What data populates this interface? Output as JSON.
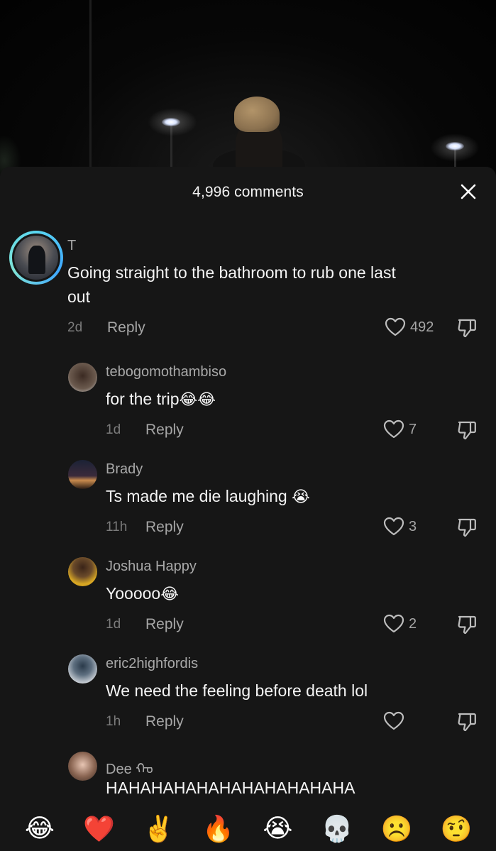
{
  "header": {
    "title": "4,996 comments",
    "close_icon": "close-icon"
  },
  "comments": [
    {
      "username": "T",
      "text_line1": "Going straight to the bathroom to rub one last",
      "text_line2": "out",
      "time": "2d",
      "reply": "Reply",
      "likes": "492"
    },
    {
      "username": "tebogomothambiso",
      "text": "for the trip",
      "emoji": "😂😂",
      "time": "1d",
      "reply": "Reply",
      "likes": "7"
    },
    {
      "username": "Brady",
      "text": "Ts made me die laughing ",
      "emoji": "😭",
      "time": "11h",
      "reply": "Reply",
      "likes": "3"
    },
    {
      "username": "Joshua Happy",
      "text": "Yooooo",
      "emoji": "😂",
      "time": "1d",
      "reply": "Reply",
      "likes": "2"
    },
    {
      "username": "eric2highfordis",
      "text": "We need the feeling before death lol",
      "time": "1h",
      "reply": "Reply",
      "likes": ""
    },
    {
      "username": "Dee ᠬᠣ",
      "text": "HAHAHAHAHAHAHAHAHAHAHA"
    }
  ],
  "emoji_bar": [
    "😂",
    "❤️",
    "✌️",
    "🔥",
    "😭",
    "💀",
    "☹️",
    "🤨"
  ],
  "colors": {
    "sheet_bg": "#161616",
    "text_primary": "#f4f4f4",
    "text_secondary": "#a6a6a6",
    "avatar_ring": "#5ad7f0"
  }
}
